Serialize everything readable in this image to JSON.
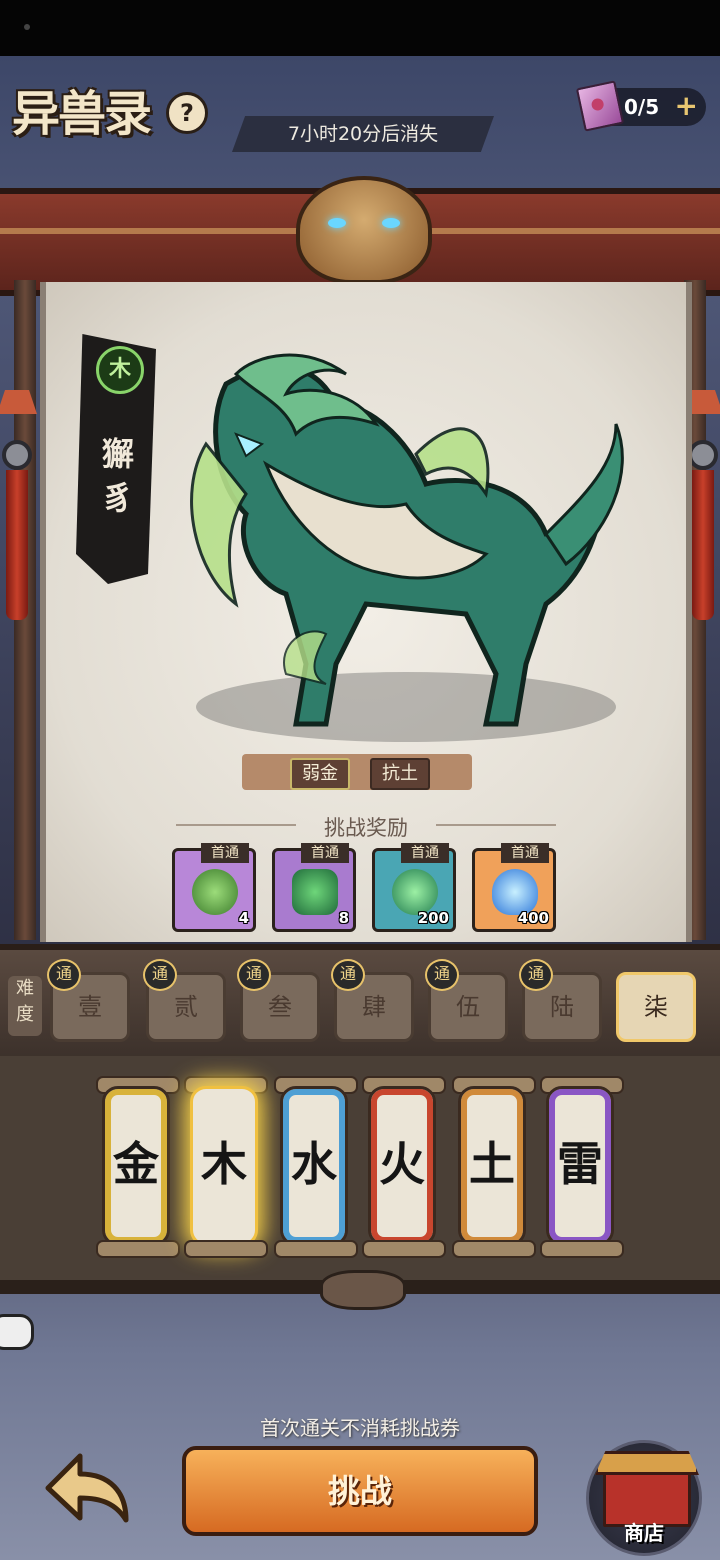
{
  "header": {
    "title": "异兽录",
    "help_icon": "?",
    "timer": "7小时20分后消失",
    "tickets": "0/5",
    "add_icon": "+"
  },
  "beast": {
    "element": "木",
    "name": "獬豸",
    "tags": [
      "弱金",
      "抗土"
    ]
  },
  "rewards": {
    "title": "挑战奖励",
    "items": [
      {
        "tag": "首通",
        "qty": "4",
        "color": "#b887d8",
        "icon": "green-egg-icon"
      },
      {
        "tag": "首通",
        "qty": "8",
        "color": "#a97bcf",
        "icon": "beast-fragment-icon"
      },
      {
        "tag": "首通",
        "qty": "200",
        "color": "#4aa6b4",
        "icon": "green-orb-icon"
      },
      {
        "tag": "首通",
        "qty": "400",
        "color": "#f0a15a",
        "icon": "blue-flame-icon"
      }
    ]
  },
  "difficulty": {
    "label": "难度",
    "pass_mark": "通",
    "levels": [
      "壹",
      "贰",
      "叁",
      "肆",
      "伍",
      "陆",
      "柒"
    ],
    "selected": "柒"
  },
  "elements": {
    "items": [
      "金",
      "木",
      "水",
      "火",
      "土",
      "雷"
    ],
    "selected": "木",
    "ring_colors": [
      "#d8b23a",
      "#5fae5a",
      "#4e9fd4",
      "#c8462e",
      "#d08a3a",
      "#8a56c4"
    ]
  },
  "footer": {
    "hint": "首次通关不消耗挑战券",
    "challenge": "挑战",
    "shop": "商店"
  }
}
